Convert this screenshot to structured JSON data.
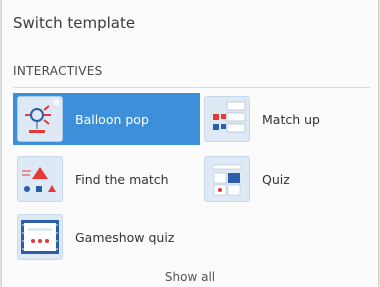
{
  "panel": {
    "title": "Switch template",
    "section_label": "INTERACTIVES",
    "show_all_label": "Show all"
  },
  "templates": [
    {
      "label": "Balloon pop",
      "icon": "balloon-pop-thumbnail-icon",
      "selected": true
    },
    {
      "label": "Match up",
      "icon": "match-up-thumbnail-icon",
      "selected": false
    },
    {
      "label": "Find the match",
      "icon": "find-the-match-thumbnail-icon",
      "selected": false
    },
    {
      "label": "Quiz",
      "icon": "quiz-thumbnail-icon",
      "selected": false
    },
    {
      "label": "Gameshow quiz",
      "icon": "gameshow-quiz-thumbnail-icon",
      "selected": false
    }
  ],
  "colors": {
    "selected_background": "#3d8fda",
    "thumbnail_background": "#dde9f4"
  }
}
